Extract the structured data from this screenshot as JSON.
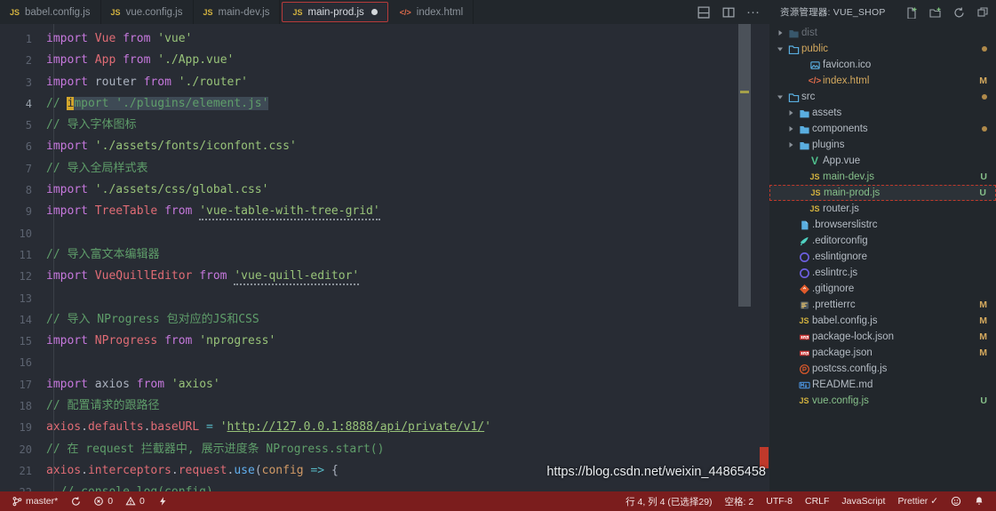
{
  "window": {
    "theme_bg": "#282c34",
    "accent": "#b83b3b"
  },
  "tabs": [
    {
      "label": "babel.config.js",
      "icon": "js-file-icon",
      "icon_text": "JS",
      "active": false,
      "dirty": false
    },
    {
      "label": "vue.config.js",
      "icon": "js-file-icon",
      "icon_text": "JS",
      "active": false,
      "dirty": false
    },
    {
      "label": "main-dev.js",
      "icon": "js-file-icon",
      "icon_text": "JS",
      "active": false,
      "dirty": false
    },
    {
      "label": "main-prod.js",
      "icon": "js-file-icon",
      "icon_text": "JS",
      "active": true,
      "dirty": true
    },
    {
      "label": "index.html",
      "icon": "html-file-icon",
      "icon_text": "</>",
      "active": false,
      "dirty": false
    }
  ],
  "editor_actions": [
    {
      "name": "split-editor-down-icon"
    },
    {
      "name": "split-editor-right-icon"
    },
    {
      "name": "more-actions-icon",
      "glyph": "···"
    }
  ],
  "explorer": {
    "title": "资源管理器: VUE_SHOP",
    "actions": [
      {
        "name": "new-file-icon"
      },
      {
        "name": "new-folder-icon"
      },
      {
        "name": "refresh-explorer-icon"
      },
      {
        "name": "collapse-all-icon"
      }
    ],
    "items": [
      {
        "name": "dist",
        "kind": "folder",
        "expanded": false,
        "indent": 0,
        "color": "dim",
        "icon": "folder-icon",
        "icon_text": "",
        "badge": ""
      },
      {
        "name": "public",
        "kind": "folder",
        "expanded": true,
        "indent": 0,
        "color": "mod",
        "icon": "folder-open-icon",
        "icon_text": "",
        "badge": "dot"
      },
      {
        "name": "favicon.ico",
        "kind": "file",
        "expanded": null,
        "indent": 2,
        "color": "norm",
        "icon": "image-file-icon",
        "icon_text": "",
        "badge": ""
      },
      {
        "name": "index.html",
        "kind": "file",
        "expanded": null,
        "indent": 2,
        "color": "mod",
        "icon": "html-file-icon",
        "icon_text": "</>",
        "badge": "M"
      },
      {
        "name": "src",
        "kind": "folder",
        "expanded": true,
        "indent": 0,
        "color": "norm",
        "icon": "folder-open-icon",
        "icon_text": "",
        "badge": "dot"
      },
      {
        "name": "assets",
        "kind": "folder",
        "expanded": false,
        "indent": 1,
        "color": "norm",
        "icon": "folder-icon",
        "icon_text": "",
        "badge": ""
      },
      {
        "name": "components",
        "kind": "folder",
        "expanded": false,
        "indent": 1,
        "color": "norm",
        "icon": "folder-icon",
        "icon_text": "",
        "badge": "dot"
      },
      {
        "name": "plugins",
        "kind": "folder",
        "expanded": false,
        "indent": 1,
        "color": "norm",
        "icon": "folder-icon",
        "icon_text": "",
        "badge": ""
      },
      {
        "name": "App.vue",
        "kind": "file",
        "expanded": null,
        "indent": 2,
        "color": "norm",
        "icon": "vue-file-icon",
        "icon_text": "V",
        "badge": ""
      },
      {
        "name": "main-dev.js",
        "kind": "file",
        "expanded": null,
        "indent": 2,
        "color": "new",
        "icon": "js-file-icon",
        "icon_text": "JS",
        "badge": "U"
      },
      {
        "name": "main-prod.js",
        "kind": "file",
        "expanded": null,
        "indent": 2,
        "color": "new",
        "icon": "js-file-icon",
        "icon_text": "JS",
        "badge": "U",
        "selected": true
      },
      {
        "name": "router.js",
        "kind": "file",
        "expanded": null,
        "indent": 2,
        "color": "norm",
        "icon": "js-file-icon",
        "icon_text": "JS",
        "badge": ""
      },
      {
        "name": ".browserslistrc",
        "kind": "file",
        "expanded": null,
        "indent": 1,
        "color": "norm",
        "icon": "text-file-icon",
        "icon_text": "",
        "badge": ""
      },
      {
        "name": ".editorconfig",
        "kind": "file",
        "expanded": null,
        "indent": 1,
        "color": "norm",
        "icon": "editorconfig-icon",
        "icon_text": "",
        "badge": ""
      },
      {
        "name": ".eslintignore",
        "kind": "file",
        "expanded": null,
        "indent": 1,
        "color": "norm",
        "icon": "eslint-icon",
        "icon_text": "",
        "badge": ""
      },
      {
        "name": ".eslintrc.js",
        "kind": "file",
        "expanded": null,
        "indent": 1,
        "color": "norm",
        "icon": "eslint-icon",
        "icon_text": "",
        "badge": ""
      },
      {
        "name": ".gitignore",
        "kind": "file",
        "expanded": null,
        "indent": 1,
        "color": "norm",
        "icon": "git-icon",
        "icon_text": "",
        "badge": ""
      },
      {
        "name": ".prettierrc",
        "kind": "file",
        "expanded": null,
        "indent": 1,
        "color": "norm",
        "icon": "prettier-icon",
        "icon_text": "",
        "badge": "M"
      },
      {
        "name": "babel.config.js",
        "kind": "file",
        "expanded": null,
        "indent": 1,
        "color": "norm",
        "icon": "js-file-icon",
        "icon_text": "JS",
        "badge": "M"
      },
      {
        "name": "package-lock.json",
        "kind": "file",
        "expanded": null,
        "indent": 1,
        "color": "norm",
        "icon": "npm-icon",
        "icon_text": "",
        "badge": "M"
      },
      {
        "name": "package.json",
        "kind": "file",
        "expanded": null,
        "indent": 1,
        "color": "norm",
        "icon": "npm-icon",
        "icon_text": "",
        "badge": "M"
      },
      {
        "name": "postcss.config.js",
        "kind": "file",
        "expanded": null,
        "indent": 1,
        "color": "norm",
        "icon": "postcss-icon",
        "icon_text": "",
        "badge": ""
      },
      {
        "name": "README.md",
        "kind": "file",
        "expanded": null,
        "indent": 1,
        "color": "norm",
        "icon": "markdown-icon",
        "icon_text": "",
        "badge": ""
      },
      {
        "name": "vue.config.js",
        "kind": "file",
        "expanded": null,
        "indent": 1,
        "color": "new",
        "icon": "js-file-icon",
        "icon_text": "JS",
        "badge": "U"
      }
    ]
  },
  "code": {
    "lines": [
      {
        "n": "1",
        "tokens": [
          {
            "t": "import",
            "c": "kw"
          },
          {
            "t": " ",
            "c": "plain"
          },
          {
            "t": "Vue",
            "c": "cls"
          },
          {
            "t": " ",
            "c": "plain"
          },
          {
            "t": "from",
            "c": "kw"
          },
          {
            "t": " ",
            "c": "plain"
          },
          {
            "t": "'vue'",
            "c": "str"
          }
        ]
      },
      {
        "n": "2",
        "tokens": [
          {
            "t": "import",
            "c": "kw"
          },
          {
            "t": " ",
            "c": "plain"
          },
          {
            "t": "App",
            "c": "cls"
          },
          {
            "t": " ",
            "c": "plain"
          },
          {
            "t": "from",
            "c": "kw"
          },
          {
            "t": " ",
            "c": "plain"
          },
          {
            "t": "'./App.vue'",
            "c": "str"
          }
        ]
      },
      {
        "n": "3",
        "tokens": [
          {
            "t": "import",
            "c": "kw"
          },
          {
            "t": " ",
            "c": "plain"
          },
          {
            "t": "router",
            "c": "plain"
          },
          {
            "t": " ",
            "c": "plain"
          },
          {
            "t": "from",
            "c": "kw"
          },
          {
            "t": " ",
            "c": "plain"
          },
          {
            "t": "'./router'",
            "c": "str"
          }
        ]
      },
      {
        "n": "4",
        "current": true,
        "tokens": [
          {
            "t": "// ",
            "c": "com"
          },
          {
            "t": "i",
            "c": "com",
            "cursor": true
          },
          {
            "t": "mport './plugins/element.js'",
            "c": "com",
            "sel": true
          }
        ]
      },
      {
        "n": "5",
        "tokens": [
          {
            "t": "// 导入字体图标",
            "c": "com"
          }
        ]
      },
      {
        "n": "6",
        "tokens": [
          {
            "t": "import",
            "c": "kw"
          },
          {
            "t": " ",
            "c": "plain"
          },
          {
            "t": "'./assets/fonts/iconfont.css'",
            "c": "str"
          }
        ]
      },
      {
        "n": "7",
        "tokens": [
          {
            "t": "// 导入全局样式表",
            "c": "com"
          }
        ]
      },
      {
        "n": "8",
        "tokens": [
          {
            "t": "import",
            "c": "kw"
          },
          {
            "t": " ",
            "c": "plain"
          },
          {
            "t": "'./assets/css/global.css'",
            "c": "str"
          }
        ]
      },
      {
        "n": "9",
        "tokens": [
          {
            "t": "import",
            "c": "kw"
          },
          {
            "t": " ",
            "c": "plain"
          },
          {
            "t": "TreeTable",
            "c": "cls"
          },
          {
            "t": " ",
            "c": "plain"
          },
          {
            "t": "from",
            "c": "kw"
          },
          {
            "t": " ",
            "c": "plain"
          },
          {
            "t": "'vue-table-with-tree-grid'",
            "c": "str",
            "squiggle": true
          }
        ]
      },
      {
        "n": "10",
        "tokens": []
      },
      {
        "n": "11",
        "tokens": [
          {
            "t": "// 导入富文本编辑器",
            "c": "com"
          }
        ]
      },
      {
        "n": "12",
        "tokens": [
          {
            "t": "import",
            "c": "kw"
          },
          {
            "t": " ",
            "c": "plain"
          },
          {
            "t": "VueQuillEditor",
            "c": "cls"
          },
          {
            "t": " ",
            "c": "plain"
          },
          {
            "t": "from",
            "c": "kw"
          },
          {
            "t": " ",
            "c": "plain"
          },
          {
            "t": "'vue-quill-editor'",
            "c": "str",
            "squiggle": true
          }
        ]
      },
      {
        "n": "13",
        "tokens": []
      },
      {
        "n": "14",
        "tokens": [
          {
            "t": "// 导入 NProgress 包对应的JS和CSS",
            "c": "com"
          }
        ]
      },
      {
        "n": "15",
        "tokens": [
          {
            "t": "import",
            "c": "kw"
          },
          {
            "t": " ",
            "c": "plain"
          },
          {
            "t": "NProgress",
            "c": "cls"
          },
          {
            "t": " ",
            "c": "plain"
          },
          {
            "t": "from",
            "c": "kw"
          },
          {
            "t": " ",
            "c": "plain"
          },
          {
            "t": "'nprogress'",
            "c": "str"
          }
        ]
      },
      {
        "n": "16",
        "tokens": []
      },
      {
        "n": "17",
        "tokens": [
          {
            "t": "import",
            "c": "kw"
          },
          {
            "t": " ",
            "c": "plain"
          },
          {
            "t": "axios",
            "c": "plain"
          },
          {
            "t": " ",
            "c": "plain"
          },
          {
            "t": "from",
            "c": "kw"
          },
          {
            "t": " ",
            "c": "plain"
          },
          {
            "t": "'axios'",
            "c": "str"
          }
        ]
      },
      {
        "n": "18",
        "tokens": [
          {
            "t": "// 配置请求的跟路径",
            "c": "com"
          }
        ]
      },
      {
        "n": "19",
        "tokens": [
          {
            "t": "axios",
            "c": "var"
          },
          {
            "t": ".",
            "c": "pun"
          },
          {
            "t": "defaults",
            "c": "var"
          },
          {
            "t": ".",
            "c": "pun"
          },
          {
            "t": "baseURL",
            "c": "var"
          },
          {
            "t": " ",
            "c": "plain"
          },
          {
            "t": "=",
            "c": "op"
          },
          {
            "t": " ",
            "c": "plain"
          },
          {
            "t": "'",
            "c": "str"
          },
          {
            "t": "http://127.0.0.1:8888/api/private/v1/",
            "c": "str",
            "link": true
          },
          {
            "t": "'",
            "c": "str"
          }
        ]
      },
      {
        "n": "20",
        "tokens": [
          {
            "t": "// 在 request 拦截器中, 展示进度条 NProgress.start()",
            "c": "com"
          }
        ]
      },
      {
        "n": "21",
        "tokens": [
          {
            "t": "axios",
            "c": "var"
          },
          {
            "t": ".",
            "c": "pun"
          },
          {
            "t": "interceptors",
            "c": "var"
          },
          {
            "t": ".",
            "c": "pun"
          },
          {
            "t": "request",
            "c": "var"
          },
          {
            "t": ".",
            "c": "pun"
          },
          {
            "t": "use",
            "c": "fn"
          },
          {
            "t": "(",
            "c": "pun"
          },
          {
            "t": "config",
            "c": "prop"
          },
          {
            "t": " ",
            "c": "plain"
          },
          {
            "t": "=>",
            "c": "op"
          },
          {
            "t": " ",
            "c": "plain"
          },
          {
            "t": "{",
            "c": "pun"
          }
        ]
      },
      {
        "n": "22",
        "tokens": [
          {
            "t": "  // console.log(config)",
            "c": "com"
          }
        ]
      }
    ]
  },
  "statusbar": {
    "left": [
      {
        "name": "git-branch-status",
        "icon": "source-control-branch-icon",
        "label": "master*"
      },
      {
        "name": "sync-status",
        "icon": "sync-icon",
        "label": ""
      },
      {
        "name": "errors-status",
        "icon": "error-icon",
        "label": "0"
      },
      {
        "name": "warnings-status",
        "icon": "warning-icon",
        "label": "0"
      },
      {
        "name": "liveshare-status",
        "icon": "lightning-icon",
        "label": ""
      }
    ],
    "right": [
      {
        "name": "cursor-position-status",
        "label": "行 4, 列 4 (已选择29)"
      },
      {
        "name": "indentation-status",
        "label": "空格: 2"
      },
      {
        "name": "encoding-status",
        "label": "UTF-8"
      },
      {
        "name": "eol-status",
        "label": "CRLF"
      },
      {
        "name": "language-mode-status",
        "label": "JavaScript"
      },
      {
        "name": "prettier-status",
        "label": "Prettier ✓"
      },
      {
        "name": "smiley-feedback-status",
        "icon": "smiley-icon",
        "label": ""
      },
      {
        "name": "bell-notifications-status",
        "icon": "bell-icon",
        "label": ""
      }
    ]
  },
  "watermark": {
    "text": "https://blog.csdn.net/weixin_44865458"
  }
}
